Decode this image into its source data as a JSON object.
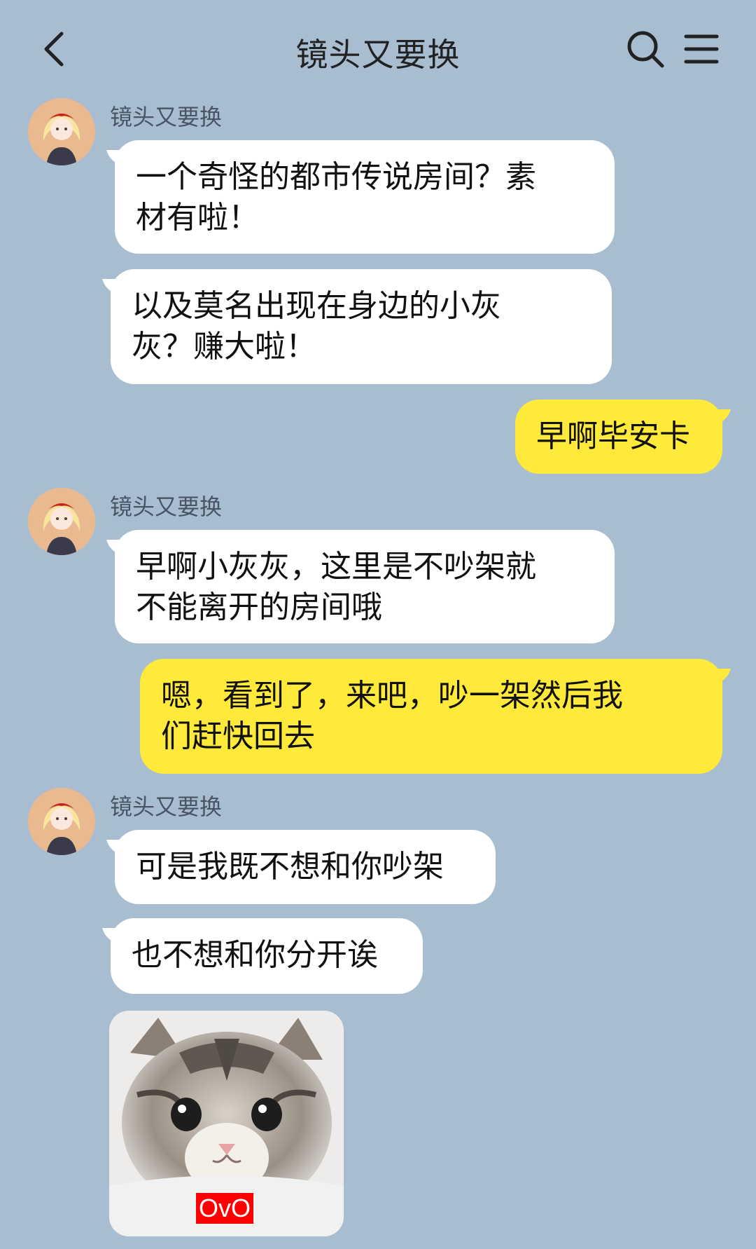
{
  "header": {
    "title": "镜头又要换",
    "back_icon": "chevron-left-icon",
    "search_icon": "search-icon",
    "menu_icon": "menu-icon"
  },
  "colors": {
    "background": "#a9bdd1",
    "incoming_bubble": "#ffffff",
    "outgoing_bubble": "#ffe93a"
  },
  "messages": [
    {
      "sender": "镜头又要换",
      "lines": [
        "一个奇怪的都市传说房间？素",
        "材有啦！"
      ]
    },
    {
      "lines": [
        "以及莫名出现在身边的小灰",
        "灰？赚大啦！"
      ]
    },
    {
      "lines": [
        "早啊毕安卡"
      ]
    },
    {
      "sender": "镜头又要换",
      "lines": [
        "早啊小灰灰，这里是不吵架就",
        "不能离开的房间哦"
      ]
    },
    {
      "lines": [
        "嗯，看到了，来吧，吵一架然后我",
        "们赶快回去"
      ]
    },
    {
      "sender": "镜头又要换",
      "lines": [
        "可是我既不想和你吵架"
      ]
    },
    {
      "lines": [
        "也不想和你分开诶"
      ]
    },
    {
      "sticker_label": "OvO"
    }
  ]
}
